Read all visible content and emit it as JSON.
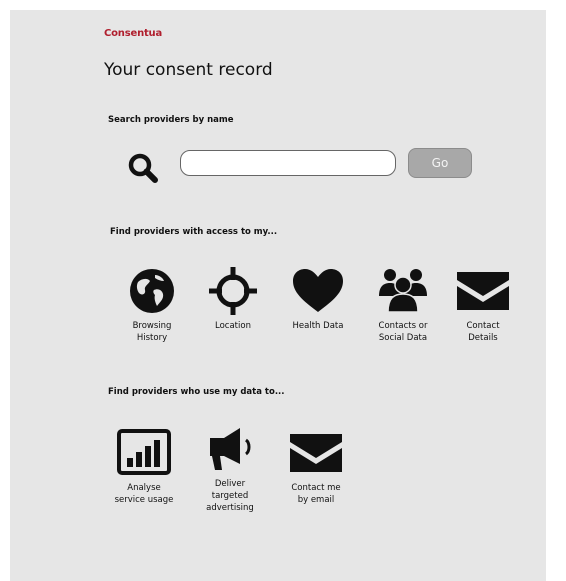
{
  "brand": "Consentua",
  "title": "Your consent record",
  "search": {
    "label": "Search providers by name",
    "input_value": "",
    "go_label": "Go"
  },
  "access": {
    "label": "Find providers with access to my...",
    "items": [
      {
        "label": "Browsing\nHistory",
        "icon": "globe-icon"
      },
      {
        "label": "Location",
        "icon": "crosshair-icon"
      },
      {
        "label": "Health Data",
        "icon": "heart-icon"
      },
      {
        "label": "Contacts or\nSocial Data",
        "icon": "people-icon"
      },
      {
        "label": "Contact\nDetails",
        "icon": "envelope-icon"
      }
    ]
  },
  "use": {
    "label": "Find providers who use my data to...",
    "items": [
      {
        "label": "Analyse\nservice usage",
        "icon": "bar-chart-icon"
      },
      {
        "label": "Deliver\ntargeted\nadvertising",
        "icon": "megaphone-icon"
      },
      {
        "label": "Contact me\nby email",
        "icon": "envelope-icon"
      }
    ]
  },
  "colors": {
    "brand": "#b01f2e",
    "panel": "#e6e6e6",
    "button": "#a8a8a8"
  }
}
